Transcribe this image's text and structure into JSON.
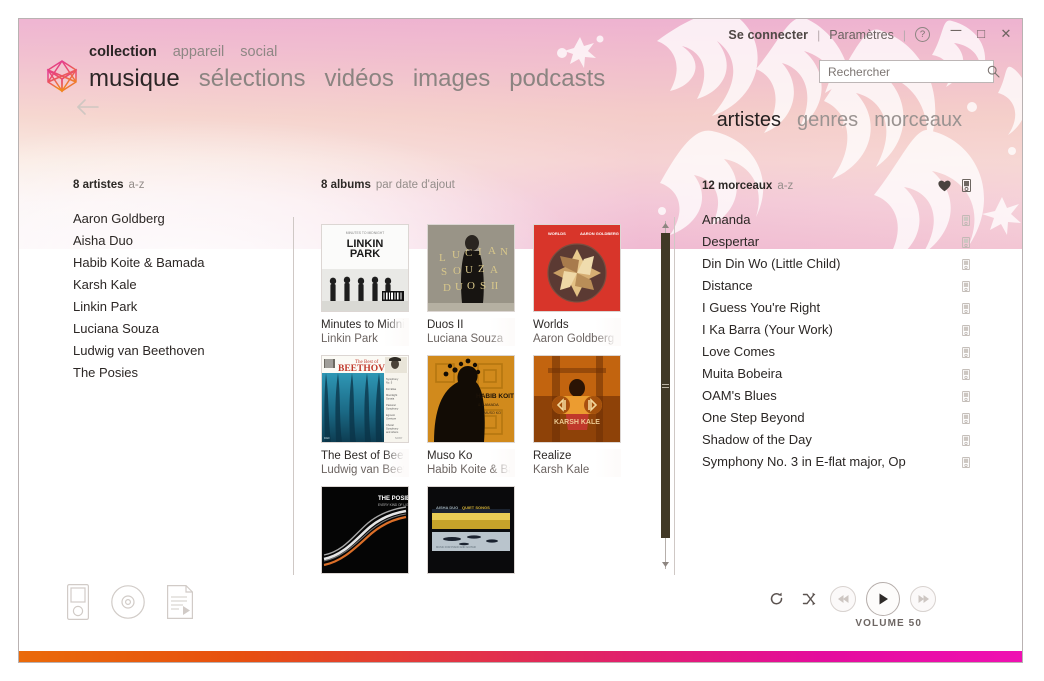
{
  "titlebar": {
    "signin": "Se connecter",
    "separator": "|",
    "settings": "Paramètres",
    "help_icon": "question-mark-icon",
    "minimize": "—",
    "maximize": "▢",
    "close": "✕"
  },
  "brand": {
    "logo_icon": "zune-logo-icon",
    "nav_upper": [
      {
        "label": "collection",
        "active": true
      },
      {
        "label": "appareil",
        "active": false
      },
      {
        "label": "social",
        "active": false
      }
    ],
    "nav_lower": [
      {
        "label": "musique",
        "active": true
      },
      {
        "label": "sélections",
        "active": false
      },
      {
        "label": "vidéos",
        "active": false
      },
      {
        "label": "images",
        "active": false
      },
      {
        "label": "podcasts",
        "active": false
      }
    ],
    "back_icon": "back-arrow-icon"
  },
  "search": {
    "placeholder": "Rechercher",
    "value": "",
    "icon": "search-icon"
  },
  "pivot": [
    {
      "label": "artistes",
      "active": true
    },
    {
      "label": "genres",
      "active": false
    },
    {
      "label": "morceaux",
      "active": false
    }
  ],
  "artists": {
    "count_label": "8 artistes",
    "sort_label": "a-z",
    "items": [
      "Aaron Goldberg",
      "Aisha Duo",
      "Habib Koite & Bamada",
      "Karsh Kale",
      "Linkin Park",
      "Luciana Souza",
      "Ludwig van Beethoven",
      "The Posies"
    ]
  },
  "albums": {
    "count_label": "8 albums",
    "sort_label": "par date d'ajout",
    "items": [
      {
        "title": "Minutes to Midnight",
        "artist": "Linkin Park",
        "art": "linkin-park-cover"
      },
      {
        "title": "Duos II",
        "artist": "Luciana Souza",
        "art": "duos-ii-cover"
      },
      {
        "title": "Worlds",
        "artist": "Aaron Goldberg",
        "art": "worlds-cover"
      },
      {
        "title": "The Best of Beethoven",
        "artist": "Ludwig van Beethoven",
        "art": "beethoven-cover"
      },
      {
        "title": "Muso Ko",
        "artist": "Habib Koite & Bamada",
        "art": "muso-ko-cover"
      },
      {
        "title": "Realize",
        "artist": "Karsh Kale",
        "art": "realize-cover"
      },
      {
        "title": "",
        "artist": "",
        "art": "posies-cover"
      },
      {
        "title": "",
        "artist": "",
        "art": "aisha-duo-cover"
      }
    ],
    "scrollbar": {
      "up_arrow": "scroll-up-arrow-icon",
      "down_arrow": "scroll-down-arrow-icon"
    }
  },
  "songs": {
    "count_label": "12 morceaux",
    "sort_label": "a-z",
    "heart_icon": "heart-icon",
    "device_icon": "device-icon",
    "items": [
      "Amanda",
      "Despertar",
      "Din Din Wo (Little Child)",
      "Distance",
      "I Guess You're Right",
      "I Ka Barra (Your Work)",
      "Love Comes",
      "Muita Bobeira",
      "OAM's Blues",
      "One Step Beyond",
      "Shadow of the Day",
      "Symphony No. 3 in E-flat major, Op"
    ]
  },
  "bottom": {
    "source_icons": [
      "device-player-icon",
      "disc-icon",
      "playlist-icon"
    ],
    "transport": {
      "repeat_icon": "repeat-icon",
      "shuffle_icon": "shuffle-icon",
      "previous_icon": "previous-icon",
      "play_icon": "play-icon",
      "next_icon": "next-icon"
    },
    "volume_label": "VOLUME 50"
  },
  "colors": {
    "accent_start": "#ea6a0a",
    "accent_end": "#ef10b2",
    "header_pink": "#f0bad2",
    "scrollbar_thumb": "#413926"
  }
}
